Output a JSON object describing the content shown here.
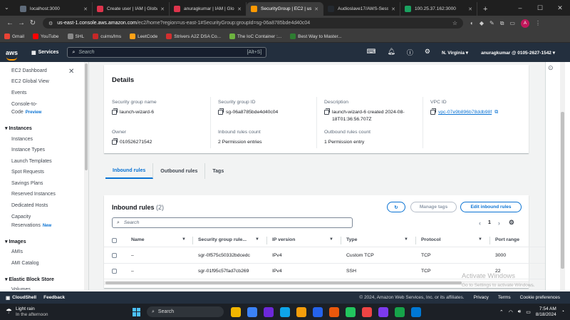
{
  "browser": {
    "tabs": [
      {
        "label": "localhost:3000",
        "color": "#5f6b7a",
        "active": false
      },
      {
        "label": "Create user | IAM | Global",
        "color": "#dd344c",
        "active": false
      },
      {
        "label": "anuragkumar | IAM | Glob",
        "color": "#dd344c",
        "active": false
      },
      {
        "label": "SecurityGroup | EC2 | us-ea",
        "color": "#ff9900",
        "active": true
      },
      {
        "label": "Audioslave17/AWS-Sessio",
        "color": "#24292f",
        "active": false
      },
      {
        "label": "100.25.37.162:3000",
        "color": "#1aa260",
        "active": false
      }
    ],
    "url_host": "us-east-1.console.aws.amazon.com",
    "url_path": "/ec2/home?region=us-east-1#SecurityGroup:groupId=sg-06a8785bde4d40c04",
    "profile_initial": "A",
    "bookmarks": [
      {
        "label": "Gmail",
        "color": "#ea4335"
      },
      {
        "label": "YouTube",
        "color": "#ff0000"
      },
      {
        "label": "SHL",
        "color": "#888888"
      },
      {
        "label": "cuims/lms",
        "color": "#c62828"
      },
      {
        "label": "LeetCode",
        "color": "#ffa116"
      },
      {
        "label": "Strivers A2Z DSA Co...",
        "color": "#d32f2f"
      },
      {
        "label": "The IoC Container :...",
        "color": "#6db33f"
      },
      {
        "label": "Best Way to Master...",
        "color": "#2e7d32"
      }
    ]
  },
  "aws": {
    "logo": "aws",
    "services": "Services",
    "search_placeholder": "Search",
    "search_shortcut": "[Alt+S]",
    "region": "N. Virginia",
    "account": "anuragkumar @ 0105-2627-1542"
  },
  "sidebar": {
    "items": [
      {
        "label": "EC2 Dashboard",
        "type": "item"
      },
      {
        "label": "EC2 Global View",
        "type": "item"
      },
      {
        "label": "Events",
        "type": "item"
      },
      {
        "label": "Console-to-",
        "type": "item"
      },
      {
        "label": "Code",
        "type": "item",
        "badge": "Preview"
      },
      {
        "label": "Instances",
        "type": "head"
      },
      {
        "label": "Instances",
        "type": "item"
      },
      {
        "label": "Instance Types",
        "type": "item"
      },
      {
        "label": "Launch Templates",
        "type": "item"
      },
      {
        "label": "Spot Requests",
        "type": "item"
      },
      {
        "label": "Savings Plans",
        "type": "item"
      },
      {
        "label": "Reserved Instances",
        "type": "item"
      },
      {
        "label": "Dedicated Hosts",
        "type": "item"
      },
      {
        "label": "Capacity",
        "type": "item"
      },
      {
        "label": "Reservations",
        "type": "item",
        "badge": "New"
      },
      {
        "label": "Images",
        "type": "head"
      },
      {
        "label": "AMIs",
        "type": "item"
      },
      {
        "label": "AMI Catalog",
        "type": "item"
      },
      {
        "label": "Elastic Block Store",
        "type": "head"
      },
      {
        "label": "Volumes",
        "type": "item"
      }
    ]
  },
  "details": {
    "title": "Details",
    "sg_name_label": "Security group name",
    "sg_name": "launch-wizard-6",
    "sg_id_label": "Security group ID",
    "sg_id": "sg-06a8785bde4d40c04",
    "description_label": "Description",
    "description": "launch-wizard-6 created 2024-08-18T01:36:56.707Z",
    "vpc_label": "VPC ID",
    "vpc_id": "vpc-07e9b896b78ddb98f",
    "owner_label": "Owner",
    "owner": "010526271542",
    "inbound_count_label": "Inbound rules count",
    "inbound_count": "2 Permission entries",
    "outbound_count_label": "Outbound rules count",
    "outbound_count": "1 Permission entry"
  },
  "tabs": [
    {
      "label": "Inbound rules",
      "selected": true
    },
    {
      "label": "Outbound rules",
      "selected": false
    },
    {
      "label": "Tags",
      "selected": false
    }
  ],
  "rules": {
    "title": "Inbound rules",
    "count": "(2)",
    "manage_tags": "Manage tags",
    "edit_inbound": "Edit inbound rules",
    "search_placeholder": "Search",
    "page": "1",
    "columns": [
      "Name",
      "Security group rule...",
      "IP version",
      "Type",
      "Protocol",
      "Port range"
    ],
    "rows": [
      {
        "name": "–",
        "rule_id": "sgr-0f575c50332bdcedc",
        "ip": "IPv4",
        "type": "Custom TCP",
        "protocol": "TCP",
        "port": "3000"
      },
      {
        "name": "–",
        "rule_id": "sgr-01f95c57fad7cb269",
        "ip": "IPv4",
        "type": "SSH",
        "protocol": "TCP",
        "port": "22"
      }
    ]
  },
  "watermark": {
    "title": "Activate Windows",
    "sub": "Go to Settings to activate Windows."
  },
  "footer": {
    "cloudshell": "CloudShell",
    "feedback": "Feedback",
    "copyright": "© 2024, Amazon Web Services, Inc. or its affiliates.",
    "privacy": "Privacy",
    "terms": "Terms",
    "cookies": "Cookie preferences"
  },
  "taskbar": {
    "weather": "Light rain",
    "weather_sub": "In the afternoon",
    "search": "Search",
    "time": "7:54 AM",
    "date": "8/18/2024",
    "apps": [
      "#f2b600",
      "#3b82f6",
      "#6d28d9",
      "#0ea5e9",
      "#f59e0b",
      "#2563eb",
      "#ea580c",
      "#22c55e",
      "#ef4444",
      "#7c3aed",
      "#16a34a",
      "#0078d4"
    ]
  }
}
